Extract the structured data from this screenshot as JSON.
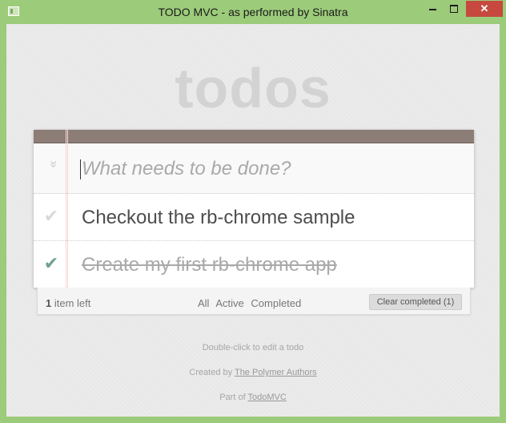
{
  "window": {
    "title": "TODO MVC - as performed by Sinatra",
    "icon": "app-window-icon",
    "controls": {
      "minimize": "minimize-icon",
      "maximize": "maximize-icon",
      "close_label": "✕"
    }
  },
  "app": {
    "logo": "todos",
    "new_todo_placeholder": "What needs to be done?",
    "toggle_all_symbol": "»",
    "todos": [
      {
        "title": "Checkout the rb-chrome sample",
        "completed": false,
        "check_symbol": "✔"
      },
      {
        "title": "Create my first rb-chrome app",
        "completed": true,
        "check_symbol": "✔"
      }
    ],
    "footer": {
      "count": "1",
      "count_suffix": " item left",
      "filters": [
        "All",
        "Active",
        "Completed"
      ],
      "clear_completed": "Clear completed (1)"
    }
  },
  "info": {
    "edit_hint": "Double-click to edit a todo",
    "created_by_prefix": "Created by ",
    "created_by_link": "The Polymer Authors",
    "part_of_prefix": "Part of ",
    "part_of_link": "TodoMVC"
  },
  "colors": {
    "window_frame": "#9ccb7a",
    "close_button": "#c7483e",
    "header_bar": "#8d7d77",
    "completed_check": "#6da38f"
  }
}
